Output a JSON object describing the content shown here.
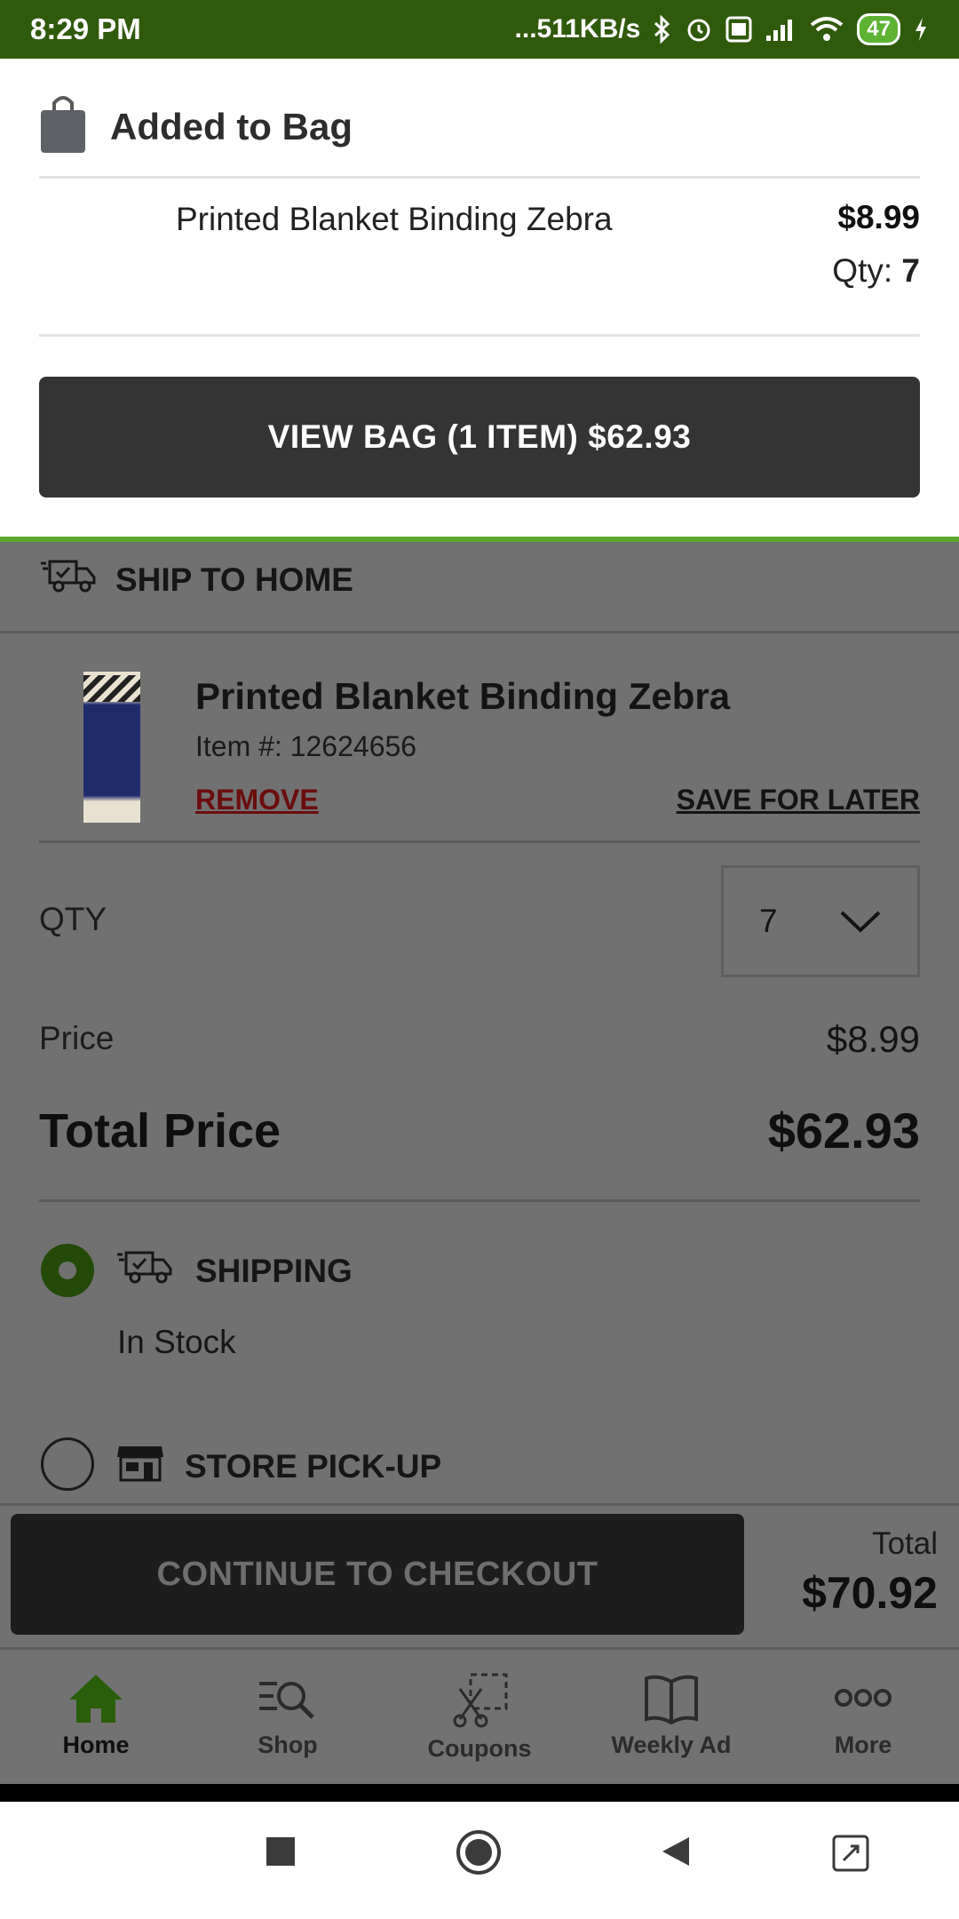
{
  "status_bar": {
    "time": "8:29 PM",
    "network_speed": "...511KB/s",
    "battery": "47",
    "background": "#2f5a0c"
  },
  "added_panel": {
    "title": "Added to Bag",
    "item_name": "Printed Blanket Binding Zebra",
    "item_price": "$8.99",
    "qty_label": "Qty:",
    "qty_value": "7",
    "view_bag_label": "VIEW BAG (1 ITEM) $62.93",
    "accent_color": "#5da82a"
  },
  "cart": {
    "section_title": "SHIP TO HOME",
    "item": {
      "name": "Printed Blanket Binding Zebra",
      "item_number": "Item #: 12624656",
      "remove_label": "REMOVE",
      "save_label": "SAVE FOR LATER"
    },
    "qty_label": "QTY",
    "qty_selected": "7",
    "price_label": "Price",
    "price_value": "$8.99",
    "total_price_label": "Total Price",
    "total_price_value": "$62.93",
    "options": [
      {
        "label": "SHIPPING",
        "selected": true,
        "detail": "In Stock"
      },
      {
        "label": "STORE PICK-UP",
        "selected": false
      }
    ]
  },
  "checkout": {
    "button_label": "CONTINUE TO CHECKOUT",
    "total_label": "Total",
    "total_value": "$70.92"
  },
  "bottom_nav": {
    "items": [
      {
        "label": "Home",
        "icon": "home-icon",
        "active": true
      },
      {
        "label": "Shop",
        "icon": "shop-search-icon",
        "active": false
      },
      {
        "label": "Coupons",
        "icon": "scissors-coupon-icon",
        "active": false
      },
      {
        "label": "Weekly Ad",
        "icon": "book-icon",
        "active": false
      },
      {
        "label": "More",
        "icon": "more-dots-icon",
        "active": false
      }
    ],
    "active_color": "#2a5e0a"
  }
}
